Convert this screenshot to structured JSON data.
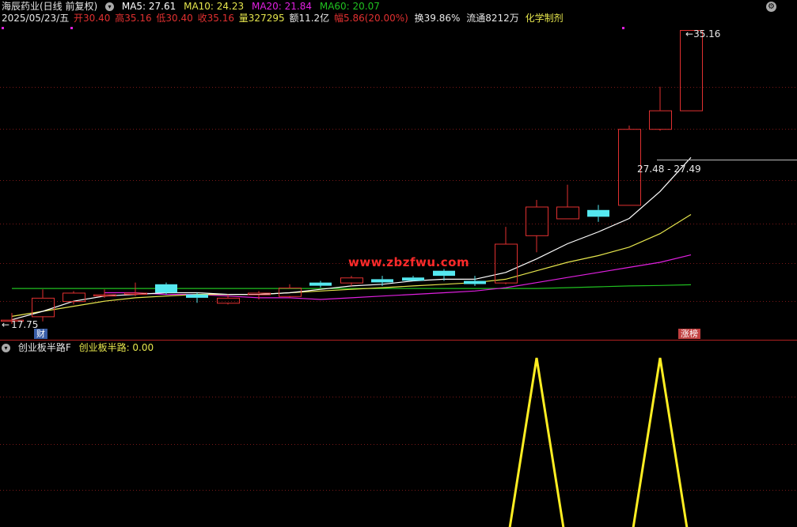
{
  "header": {
    "stock_name": "海辰药业(日线 前复权)",
    "ma5": "MA5: 27.61",
    "ma10": "MA10: 24.23",
    "ma20": "MA20: 21.84",
    "ma60": "MA60: 20.07",
    "date": "2025/05/23/五",
    "open": "开30.40",
    "high": "高35.16",
    "low": "低30.40",
    "close": "收35.16",
    "volume": "量327295",
    "amount": "额11.2亿",
    "change": "幅5.86(20.00%)",
    "turnover": "换39.86%",
    "float_shares": "流通8212万",
    "industry": "化学制剂"
  },
  "main_panel": {
    "high_label": "35.16",
    "low_label": "17.75",
    "crosshair_label": "27.48 - 27.49",
    "watermark": "www.zbzfwu.com",
    "finance_tag": "财",
    "limit_up_tag": "涨榜"
  },
  "indicator_panel": {
    "name": "创业板半路F",
    "value_label": "创业板半路: 0.00"
  },
  "colors": {
    "ma5": "#ffffff",
    "ma10": "#e6e64d",
    "ma20": "#e020e0",
    "ma60": "#20c020",
    "up": "#e03030",
    "down": "#55e8f0",
    "indicator": "#ffee22"
  },
  "chart_data": [
    {
      "type": "candlestick",
      "title": "海辰药业(日线 前复权)",
      "y_range": [
        17.75,
        35.16
      ],
      "candles": [
        {
          "open": 18.0,
          "close": 18.0,
          "high": 18.4,
          "low": 17.75
        },
        {
          "open": 18.2,
          "close": 19.3,
          "high": 19.8,
          "low": 17.9
        },
        {
          "open": 19.1,
          "close": 19.6,
          "high": 19.7,
          "low": 18.9
        },
        {
          "open": 19.5,
          "close": 19.5,
          "high": 19.8,
          "low": 19.3
        },
        {
          "open": 19.6,
          "close": 19.6,
          "high": 20.2,
          "low": 19.4
        },
        {
          "open": 20.1,
          "close": 19.6,
          "high": 20.2,
          "low": 19.5
        },
        {
          "open": 19.5,
          "close": 19.3,
          "high": 19.6,
          "low": 19.0
        },
        {
          "open": 19.0,
          "close": 19.3,
          "high": 19.5,
          "low": 18.9
        },
        {
          "open": 19.5,
          "close": 19.6,
          "high": 19.7,
          "low": 19.2
        },
        {
          "open": 19.4,
          "close": 19.9,
          "high": 20.1,
          "low": 19.3
        },
        {
          "open": 20.2,
          "close": 20.1,
          "high": 20.3,
          "low": 19.9
        },
        {
          "open": 20.2,
          "close": 20.5,
          "high": 20.6,
          "low": 20.0
        },
        {
          "open": 20.4,
          "close": 20.3,
          "high": 20.6,
          "low": 20.0
        },
        {
          "open": 20.5,
          "close": 20.4,
          "high": 20.6,
          "low": 20.3
        },
        {
          "open": 20.9,
          "close": 20.6,
          "high": 21.0,
          "low": 20.3
        },
        {
          "open": 20.3,
          "close": 20.2,
          "high": 20.6,
          "low": 20.0
        },
        {
          "open": 20.2,
          "close": 22.5,
          "high": 23.5,
          "low": 20.1
        },
        {
          "open": 23.0,
          "close": 24.7,
          "high": 25.1,
          "low": 22.0
        },
        {
          "open": 24.0,
          "close": 24.7,
          "high": 26.0,
          "low": 24.0
        },
        {
          "open": 24.5,
          "close": 24.1,
          "high": 24.8,
          "low": 23.8
        },
        {
          "open": 24.8,
          "close": 29.3,
          "high": 29.5,
          "low": 24.8
        },
        {
          "open": 29.3,
          "close": 30.4,
          "high": 31.8,
          "low": 29.2
        },
        {
          "open": 30.4,
          "close": 35.16,
          "high": 35.16,
          "low": 30.4
        }
      ],
      "ma5": [
        18.0,
        18.5,
        19.1,
        19.4,
        19.5,
        19.6,
        19.6,
        19.5,
        19.5,
        19.6,
        19.8,
        20.0,
        20.1,
        20.3,
        20.4,
        20.4,
        20.8,
        21.6,
        22.5,
        23.2,
        24.0,
        25.6,
        27.61
      ],
      "ma10": [
        18.2,
        18.5,
        18.8,
        19.1,
        19.3,
        19.4,
        19.5,
        19.5,
        19.5,
        19.6,
        19.7,
        19.8,
        19.9,
        20.0,
        20.1,
        20.2,
        20.4,
        20.9,
        21.4,
        21.8,
        22.3,
        23.1,
        24.23
      ],
      "ma20": [
        null,
        null,
        null,
        19.6,
        19.6,
        19.5,
        19.5,
        19.4,
        19.3,
        19.3,
        19.2,
        19.3,
        19.4,
        19.5,
        19.6,
        19.7,
        19.9,
        20.2,
        20.5,
        20.8,
        21.1,
        21.4,
        21.84
      ],
      "ma60": [
        19.85,
        19.85,
        19.85,
        19.85,
        19.85,
        19.85,
        19.85,
        19.85,
        19.85,
        19.85,
        19.85,
        19.85,
        19.85,
        19.85,
        19.85,
        19.85,
        19.85,
        19.85,
        19.9,
        19.95,
        20.0,
        20.03,
        20.07
      ]
    },
    {
      "type": "line",
      "title": "创业板半路F",
      "series": [
        {
          "name": "创业板半路",
          "values": [
            0,
            0,
            0,
            0,
            0,
            0,
            0,
            0,
            0,
            0,
            0,
            0,
            0,
            0,
            0,
            0,
            0,
            1,
            0,
            0,
            0,
            1,
            0
          ]
        }
      ]
    }
  ]
}
